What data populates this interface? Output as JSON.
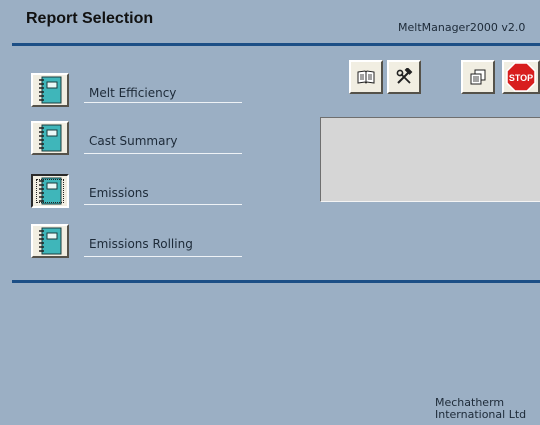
{
  "header": {
    "title": "Report Selection",
    "version": "MeltManager2000 v2.0"
  },
  "reports": [
    {
      "label": "Melt Efficiency",
      "icon": "notebook-icon"
    },
    {
      "label": "Cast Summary",
      "icon": "notebook-icon"
    },
    {
      "label": "Emissions",
      "icon": "notebook-icon",
      "selected": true
    },
    {
      "label": "Emissions Rolling",
      "icon": "notebook-icon"
    }
  ],
  "toolbar": {
    "buttons": [
      {
        "icon": "open-book-icon"
      },
      {
        "icon": "tools-icon"
      },
      {
        "icon": "copy-pages-icon"
      },
      {
        "icon": "stop-sign-icon",
        "label": "STOP"
      }
    ]
  },
  "footer": {
    "company_line1": "Mechatherm",
    "company_line2": "International Ltd"
  },
  "colors": {
    "background": "#9bafc4",
    "rule": "#1d4f86",
    "button_face": "#f1eee2",
    "notebook": "#3fb6ba",
    "stop_red": "#d81e1e",
    "preview_panel": "#d6d6d6"
  }
}
